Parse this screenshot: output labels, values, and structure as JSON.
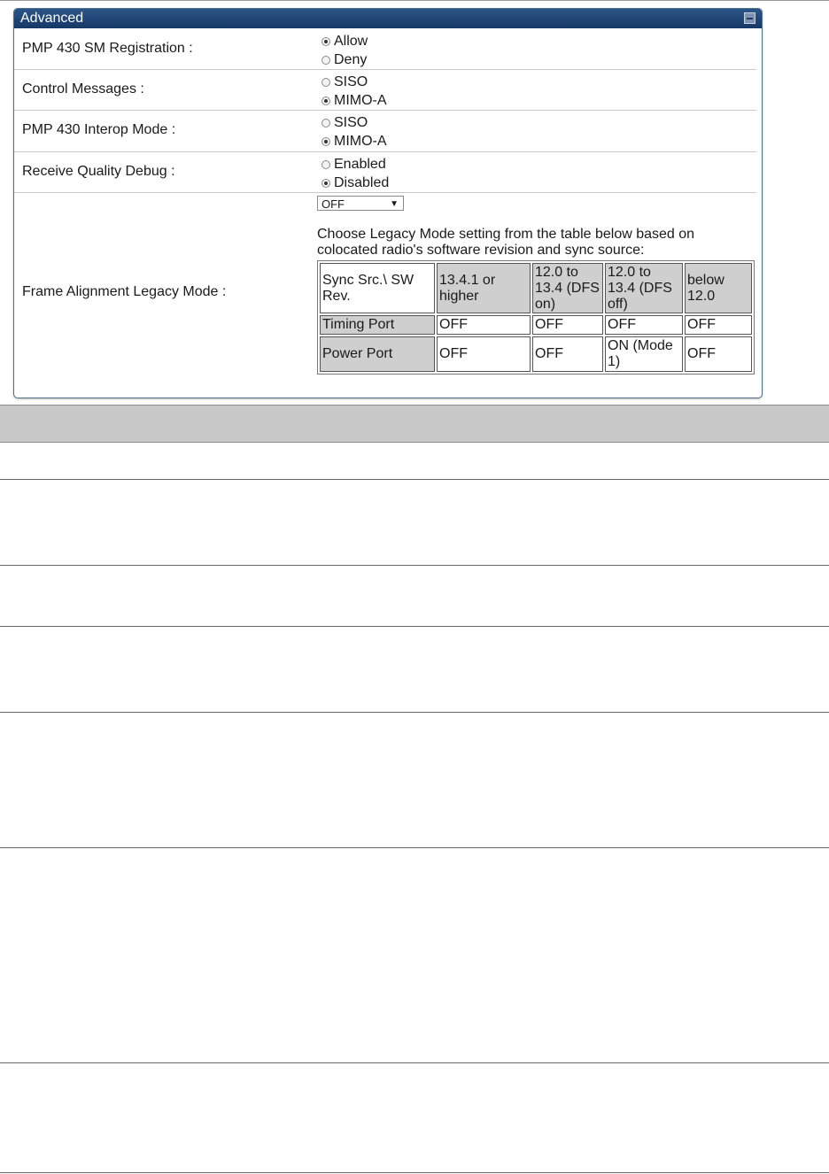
{
  "panel": {
    "title": "Advanced"
  },
  "settings": [
    {
      "label": "PMP 430 SM Registration :",
      "options": [
        {
          "label": "Allow",
          "selected": true
        },
        {
          "label": "Deny",
          "selected": false
        }
      ]
    },
    {
      "label": "Control Messages :",
      "options": [
        {
          "label": "SISO",
          "selected": false
        },
        {
          "label": "MIMO-A",
          "selected": true
        }
      ]
    },
    {
      "label": "PMP 430 Interop Mode :",
      "options": [
        {
          "label": "SISO",
          "selected": false
        },
        {
          "label": "MIMO-A",
          "selected": true
        }
      ]
    },
    {
      "label": "Receive Quality Debug :",
      "options": [
        {
          "label": "Enabled",
          "selected": false
        },
        {
          "label": "Disabled",
          "selected": true
        }
      ]
    }
  ],
  "frame_alignment": {
    "label": "Frame Alignment Legacy Mode :",
    "select_value": "OFF",
    "hint": "Choose Legacy Mode setting from the table below based on colocated radio's software revision and sync source:",
    "table": {
      "header": [
        "Sync Src.\\ SW Rev.",
        "13.4.1 or higher",
        "12.0 to 13.4 (DFS on)",
        "12.0 to 13.4 (DFS off)",
        "below 12.0"
      ],
      "rows": [
        [
          "Timing Port",
          "OFF",
          "OFF",
          "OFF",
          "OFF"
        ],
        [
          "Power Port",
          "OFF",
          "OFF",
          "ON (Mode 1)",
          "OFF"
        ]
      ]
    }
  }
}
